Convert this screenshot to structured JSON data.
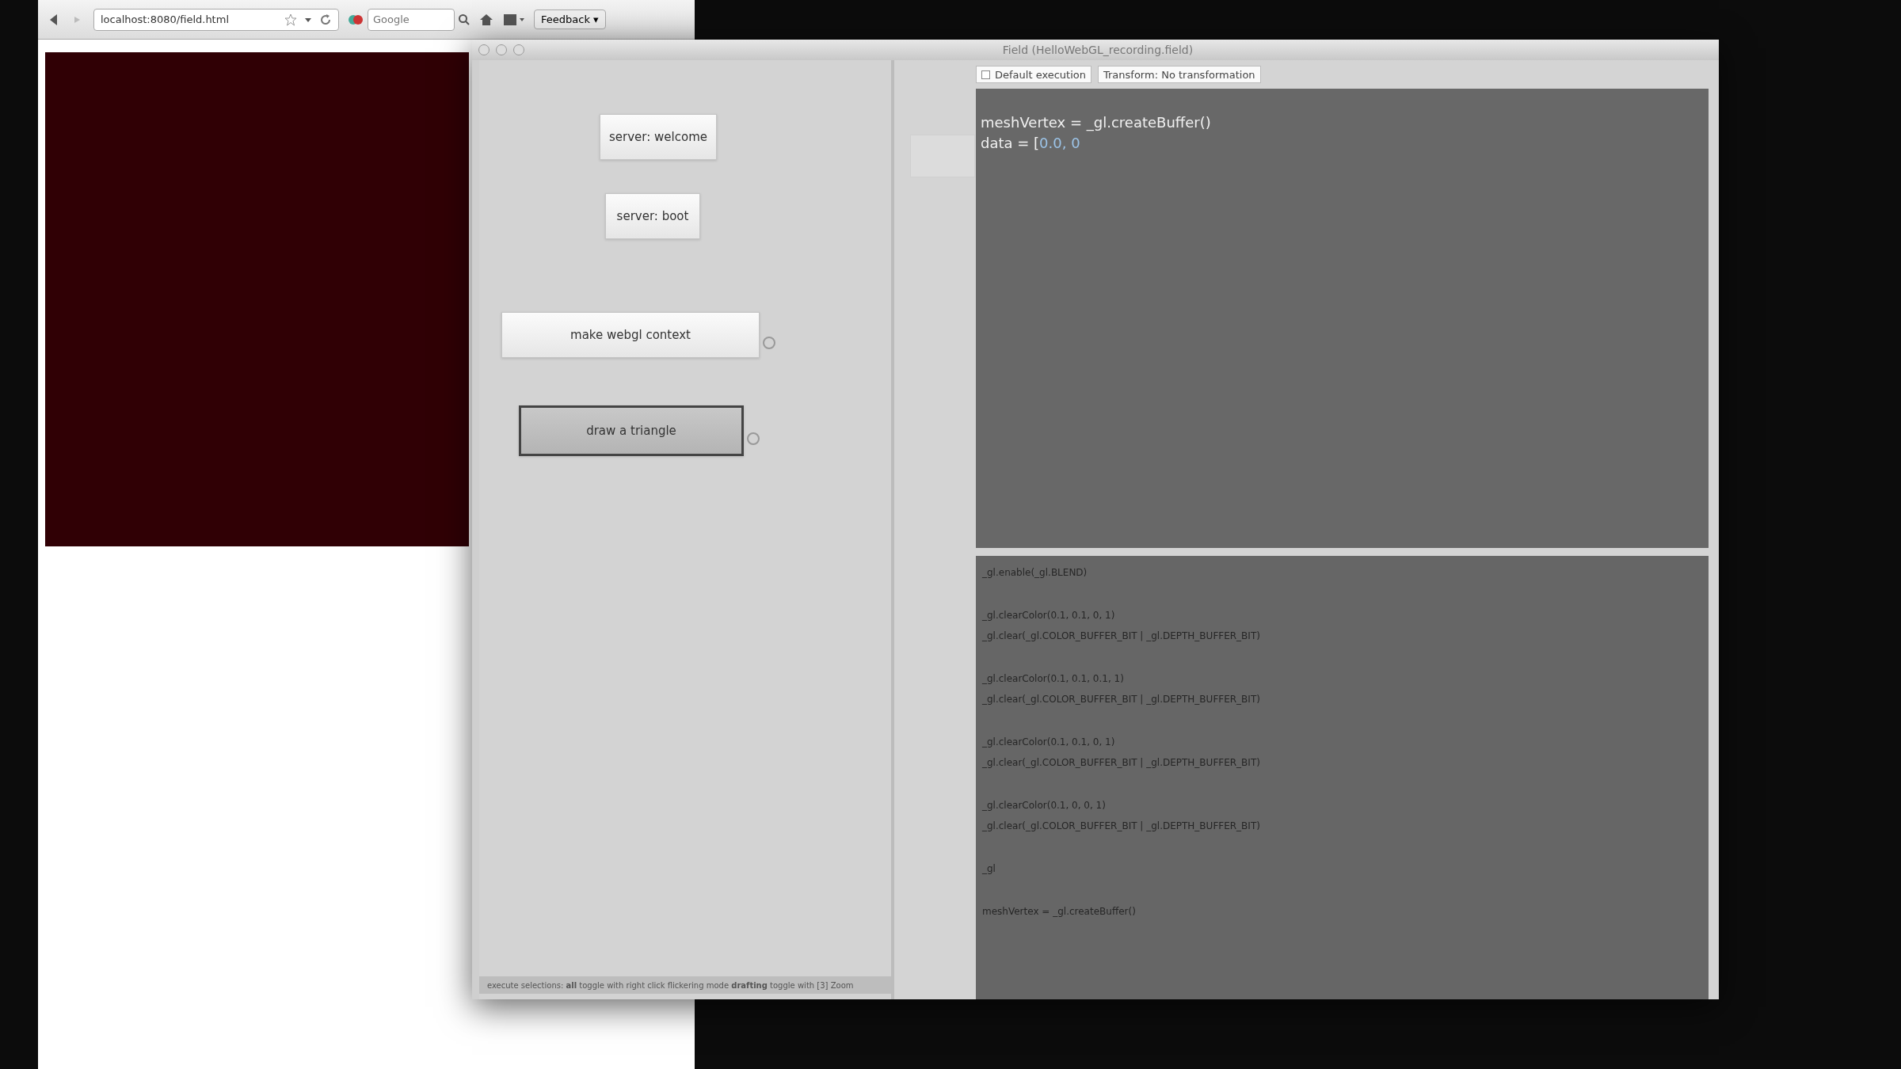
{
  "browser": {
    "url": "localhost:8080/field.html",
    "search": {
      "placeholder": "Google"
    },
    "feedback": "Feedback ▾"
  },
  "window": {
    "title": "Field (HelloWebGL_recording.field)"
  },
  "buttons": [
    {
      "label": "server: welcome",
      "selected": false,
      "handle": false
    },
    {
      "label": "server: boot",
      "selected": false,
      "handle": false
    },
    {
      "label": "make webgl context",
      "selected": false,
      "handle": true
    },
    {
      "label": "draw a triangle",
      "selected": true,
      "handle": true
    }
  ],
  "status_bar": "execute selections: **all** toggle with right click flickering mode **drafting** toggle with [3] Zoom",
  "tabs": [
    {
      "label": "Default execution",
      "checked": false
    },
    {
      "label": "Transform: No transformation"
    }
  ],
  "editor_top": [
    [
      {
        "text": "meshVertex = _gl.createBuffer()",
        "kind": "plain"
      }
    ],
    [
      {
        "text": "data = [",
        "kind": "plain"
      },
      {
        "text": "0.0, 0",
        "kind": "number"
      }
    ]
  ],
  "editor_bottom": [
    [
      "_gl.enable(_gl.BLEND)"
    ],
    [
      "_gl.clearColor(0.1, 0.1, 0, 1)",
      "_gl.clear(_gl.COLOR_BUFFER_BIT | _gl.DEPTH_BUFFER_BIT)"
    ],
    [
      "_gl.clearColor(0.1, 0.1, 0.1, 1)",
      "_gl.clear(_gl.COLOR_BUFFER_BIT | _gl.DEPTH_BUFFER_BIT)"
    ],
    [
      "_gl.clearColor(0.1, 0.1, 0, 1)",
      "_gl.clear(_gl.COLOR_BUFFER_BIT | _gl.DEPTH_BUFFER_BIT)"
    ],
    [
      "_gl.clearColor(0.1, 0, 0, 1)",
      "_gl.clear(_gl.COLOR_BUFFER_BIT | _gl.DEPTH_BUFFER_BIT)"
    ],
    [
      "_gl"
    ],
    [
      "meshVertex = _gl.createBuffer()"
    ]
  ]
}
